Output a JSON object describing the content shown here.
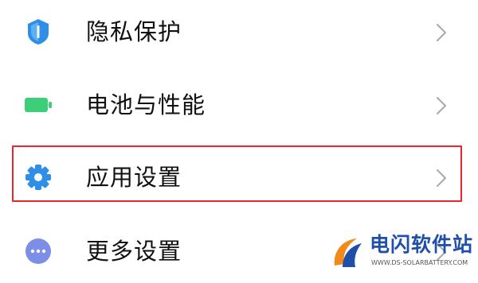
{
  "settings": {
    "items": [
      {
        "label": "隐私保护",
        "icon": "shield-icon",
        "icon_color": "#2f8fe6",
        "has_chevron": true
      },
      {
        "label": "电池与性能",
        "icon": "battery-icon",
        "icon_color": "#3ccf78",
        "has_chevron": true
      },
      {
        "label": "应用设置",
        "icon": "gear-icon",
        "icon_color": "#2f8fe6",
        "has_chevron": true,
        "highlighted": true
      },
      {
        "label": "更多设置",
        "icon": "more-dots-icon",
        "icon_color": "#7d8ee6",
        "has_chevron": true
      }
    ]
  },
  "highlight": {
    "color": "#e8262b",
    "target": "应用设置"
  },
  "watermark": {
    "title": "电闪软件站",
    "url": "WWW.DS-SOLARBATTERY.COM",
    "colors": [
      "#1f4fa8",
      "#f08a1a"
    ]
  }
}
